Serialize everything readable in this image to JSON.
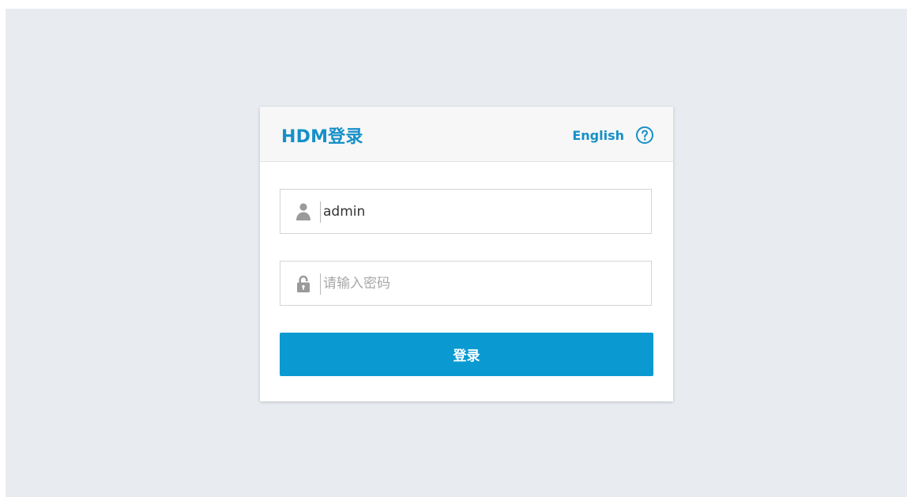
{
  "login_card": {
    "title": "HDM登录",
    "language_link": "English",
    "help_icon": "question-circle-icon",
    "username": {
      "icon": "user-icon",
      "value": "admin"
    },
    "password": {
      "icon": "lock-icon",
      "placeholder": "请输入密码",
      "value": ""
    },
    "submit_label": "登录"
  },
  "colors": {
    "page_background": "#e8ecf1",
    "accent": "#1590c8",
    "button": "#0a9ad1"
  }
}
